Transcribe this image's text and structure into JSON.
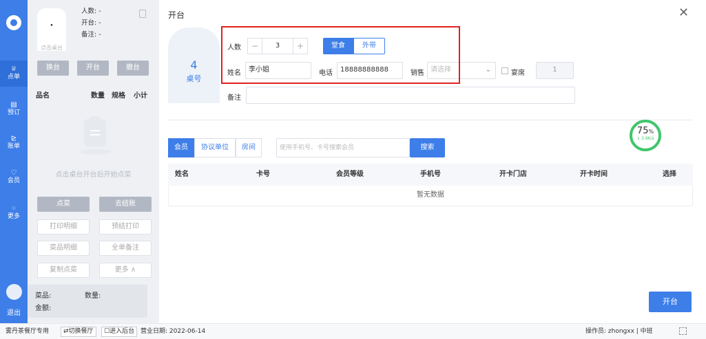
{
  "nav": {
    "items": [
      {
        "icon": "crown-icon",
        "glyph": "♕",
        "label": "点单"
      },
      {
        "icon": "calendar-icon",
        "glyph": "▤",
        "label": "预订"
      },
      {
        "icon": "bill-icon",
        "glyph": "⊵",
        "label": "账单"
      },
      {
        "icon": "member-icon",
        "glyph": "♡",
        "label": "会员"
      },
      {
        "icon": "grid-icon",
        "glyph": "⁘",
        "label": "更多"
      }
    ],
    "logout": "退出"
  },
  "order": {
    "table_placeholder": "·",
    "table_hint": "点击桌台",
    "people": "人数: -",
    "opened": "开台: -",
    "remark": "备注: -",
    "btn_change": "换台",
    "btn_open": "开台",
    "btn_cancel": "撤台",
    "col_name": "品名",
    "col_qty": "数量",
    "col_spec": "规格",
    "col_subtotal": "小计",
    "empty_hint": "点击桌台开台后开始点菜",
    "btn_order": "点菜",
    "btn_checkout": "去结账",
    "btn_print_detail": "打印明细",
    "btn_preprint": "预结打印",
    "btn_dish_detail": "菜品明细",
    "btn_note_all": "全单备注",
    "btn_copy_order": "复制点菜",
    "btn_more": "更多 ∧",
    "sum_dishes": "菜品:",
    "sum_qty": "数量:",
    "sum_amount": "金额:"
  },
  "dialog": {
    "title": "开台",
    "close": "✕",
    "table_no": "4",
    "table_label": "桌号",
    "people_label": "人数",
    "minus": "−",
    "people_value": "3",
    "plus": "+",
    "dine_in": "堂食",
    "takeaway": "外带",
    "name_label": "姓名",
    "name_value": "李小姐",
    "phone_label": "电话",
    "phone_value": "18888888888",
    "sales_label": "销售",
    "sales_placeholder": "请选择",
    "banquet_label": "宴席",
    "banquet_value": "1",
    "remark_label": "备注",
    "remark_value": "",
    "tabs": [
      "会员",
      "协议单位",
      "房间"
    ],
    "search_placeholder": "使用手机号、卡号搜索会员",
    "search_btn": "搜索",
    "columns": [
      "姓名",
      "卡号",
      "会员等级",
      "手机号",
      "开卡门店",
      "开卡时间",
      "选择"
    ],
    "empty": "暂无数据",
    "gauge_pct": "75",
    "gauge_unit": "%",
    "gauge_speed": "↓ 3.9K/s",
    "open_btn": "开台"
  },
  "footer": {
    "store": "雾丹茶餐厅专用",
    "switch": "⇄切换餐厅",
    "backend": "☐进入后台",
    "biz_date": "营业日期: 2022-06-14",
    "operator": "操作员: zhongxx | 中班"
  },
  "colors": {
    "primary": "#3d7ee8",
    "highlight": "#e02020",
    "gauge": "#41c66c"
  }
}
